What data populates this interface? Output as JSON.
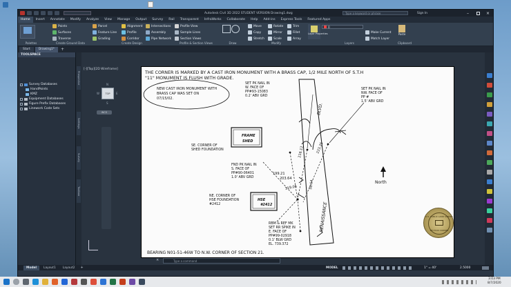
{
  "desktop_icons": [
    "a",
    "b"
  ],
  "window": {
    "title": "Autodesk Civil 3D 2022  STUDENT VERSION  Drawing1.dwg",
    "search_placeholder": "Type a keyword or phrase",
    "user": "Sign In"
  },
  "ribbon_tabs": [
    "Home",
    "Insert",
    "Annotate",
    "Modify",
    "Analyze",
    "View",
    "Manage",
    "Output",
    "Survey",
    "Rail",
    "Transparent",
    "InfraWorks",
    "Collaborate",
    "Help",
    "Add-ins",
    "Express Tools",
    "Featured Apps"
  ],
  "ribbon": {
    "palettes": "Palettes",
    "create_ground": "Create Ground Data",
    "create_design": "Create Design",
    "profile_section": "Profile & Section Views",
    "draw": "Draw",
    "modify": "Modify",
    "layers": "Layers",
    "clipboard": "Clipboard",
    "points": "Points",
    "surfaces": "Surfaces",
    "traverse": "Traverse",
    "parcel": "Parcel",
    "feature_line": "Feature Line",
    "grading": "Grading",
    "alignment": "Alignment",
    "profile": "Profile",
    "corridor": "Corridor",
    "intersections": "Intersections",
    "assembly": "Assembly",
    "pipe_network": "Pipe Network",
    "profile_view": "Profile View",
    "sample_lines": "Sample Lines",
    "section_views": "Section Views",
    "move": "Move",
    "copy": "Copy",
    "stretch": "Stretch",
    "rotate": "Rotate",
    "mirror": "Mirror",
    "scale": "Scale",
    "trim": "Trim",
    "fillet": "Fillet",
    "array": "Array",
    "layer_properties": "Layer Properties",
    "make_current": "Make Current",
    "match_layer": "Match Layer",
    "paste": "Paste",
    "layer_value": "0"
  },
  "doc_tabs": [
    "Start",
    "Drawing1*"
  ],
  "toolspace": {
    "title": "TOOLSPACE",
    "items": [
      "Survey Databases",
      "HandPoints",
      "KMZ",
      "Equipment Databases",
      "Figure Prefix Databases",
      "Linework Code Sets"
    ]
  },
  "side_tabs": [
    "Prospector",
    "Settings",
    "Survey",
    "Toolbox"
  ],
  "viewport_label": "[-][Top][2D Wireframe]",
  "viewcube": {
    "top": "TOP",
    "n": "N",
    "s": "S",
    "e": "E",
    "w": "W",
    "wcs": "WCS"
  },
  "drawing": {
    "header1": "THE CORNER IS MARKED BY A CAST IRON MONUMENT WITH A BRASS CAP, 1/2 MILE NORTH OF S.T.H",
    "header2": "\"11\" MONUMENT IS FLUSH WITH GRADE.",
    "note1": "NEW CAST IRON MONUMENT WITH",
    "note2": "BRASS CAP WAS SET ON",
    "note3": "07/15/02.",
    "frame1": "FRAME",
    "frame2": "SHED",
    "se1": "SE. CORNER OF",
    "se2": "SHED FOUNDATION",
    "pk_w1": "SET PK NAIL IN",
    "pk_w2": "W. FACE OF",
    "pk_w3": "PP#93-15083",
    "pk_w4": "0.2' ABV GRD",
    "pk_nw1": "SET PK NAIL IN",
    "pk_nw2": "NW. FACE OF",
    "pk_nw3": "PP #",
    "pk_nw4": "1.5' ABV GRD",
    "fnd1": "FND PK NAIL IN",
    "fnd2": "S. FACE OF",
    "fnd3": "PP#90-06401",
    "fnd4": "1.0' ABV GRD",
    "ne1": "NE. CORNER OF",
    "ne2": "HSE FOUNDATION",
    "ne3": "#2412",
    "hse1": "HSE",
    "hse2": "#2412",
    "rbm1": "RBM & REF MK",
    "rbm2": "SET RR SPIKE IN",
    "rbm3": "E. FACE OF",
    "rbm4": "PP#99-02918",
    "rbm5": "0.1' BLW GRD",
    "rbm6": "EL. 739.372",
    "blvd": "BLVD.",
    "renaissance": "RENAISSANCE",
    "north": "North",
    "d1": "199.21",
    "d2": "203.64",
    "d3": "119.06",
    "d4": "216.12",
    "d5": "223.25",
    "d6": "58.64",
    "bearing": "BEARING N01-51-46W TO N.W. CORNER OF SECTION 21.",
    "seal_top": "U.S. PUBLIC LAND SURVEY",
    "seal_bottom": "SECTION CORNER"
  },
  "layout_tabs": [
    "Model",
    "Layout1",
    "Layout2"
  ],
  "command_placeholder": "Type a command",
  "status": {
    "model": "MODEL",
    "scale": "1\" = 40'",
    "decimal": "2.5000"
  },
  "taskbar": {
    "time": "3:03 PM",
    "date": "8/7/2020"
  }
}
